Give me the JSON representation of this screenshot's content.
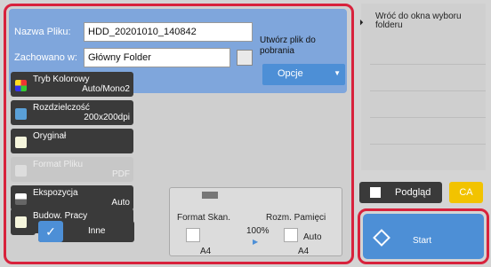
{
  "form": {
    "filename_label": "Nazwa Pliku:",
    "filename_value": "HDD_20201010_140842",
    "saved_label": "Zachowano w:",
    "saved_value": "Główny Folder",
    "create_label_line1": "Utwórz plik do",
    "create_label_line2": "pobrania",
    "options_label": "Opcje"
  },
  "settings": [
    {
      "title": "Tryb Kolorowy",
      "value": "Auto/Mono2",
      "icon": "color-mode-icon",
      "enabled": true
    },
    {
      "title": "Rozdzielczość",
      "value": "200x200dpi",
      "icon": "resolution-icon",
      "enabled": true
    },
    {
      "title": "Oryginał",
      "value": "",
      "icon": "original-icon",
      "enabled": true
    },
    {
      "title": "Format Pliku",
      "value": "PDF",
      "icon": "file-format-icon",
      "enabled": false
    },
    {
      "title": "Ekspozycja",
      "value": "Auto",
      "icon": "exposure-icon",
      "enabled": true
    },
    {
      "title": "Budow. Pracy",
      "value": "",
      "icon": "job-build-icon",
      "enabled": true
    }
  ],
  "other_label": "Inne",
  "scan_info": {
    "format_label": "Format Skan.",
    "memory_label": "Rozm. Pamięci",
    "ratio": "100%",
    "scan_size": "A4",
    "memory_size": "A4",
    "auto_label": "Auto"
  },
  "right": {
    "back_line1": "Wróć do okna wyboru",
    "back_line2": "folderu",
    "preview_label": "Podgląd",
    "ca_label": "CA",
    "start_label": "Start"
  },
  "colors": {
    "accent_blue": "#4d8fd6",
    "highlight_red": "#d8223c",
    "ca_yellow": "#f2c300"
  }
}
